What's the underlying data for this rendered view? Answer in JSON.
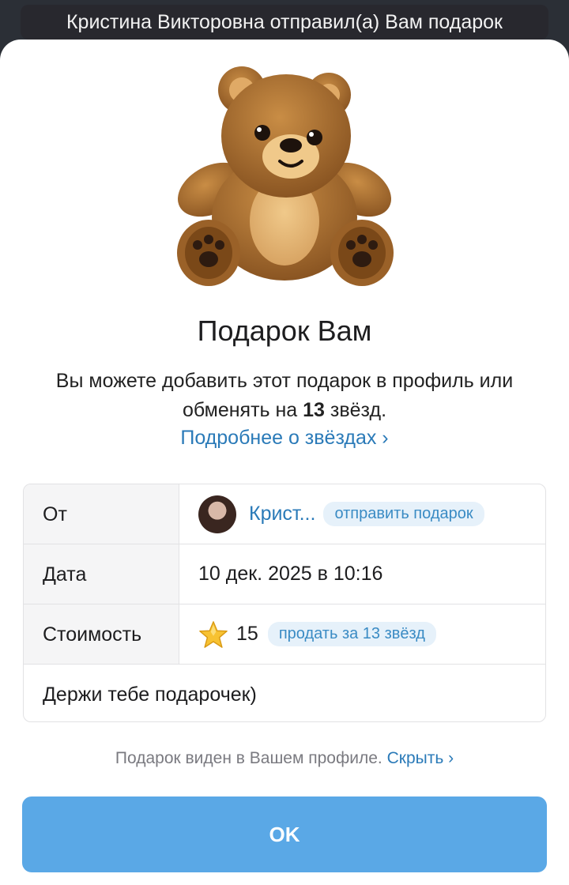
{
  "toast": {
    "text": "Кристина Викторовна отправил(а) Вам подарок"
  },
  "gift": {
    "image_icon": "teddy-bear",
    "title": "Подарок Вам",
    "desc_part1": "Вы можете добавить этот подарок в профиль или обменять на ",
    "desc_stars": "13",
    "desc_part2": " звёзд.",
    "more_link": "Подробнее о звёздах ›"
  },
  "details": {
    "from_label": "От",
    "from_name": "Крист...",
    "send_gift_label": "отправить подарок",
    "date_label": "Дата",
    "date_value": "10 дек. 2025 в 10:16",
    "cost_label": "Стоимость",
    "cost_icon": "star",
    "cost_value": "15",
    "sell_label": "продать за 13 звёзд",
    "message": "Держи тебе подарочек)"
  },
  "footer": {
    "note": "Подарок виден в Вашем профиле.",
    "hide_link": "Скрыть ›"
  },
  "button": {
    "ok_label": "OK"
  },
  "colors": {
    "accent": "#2a7ab8",
    "button": "#5aa8e6"
  }
}
